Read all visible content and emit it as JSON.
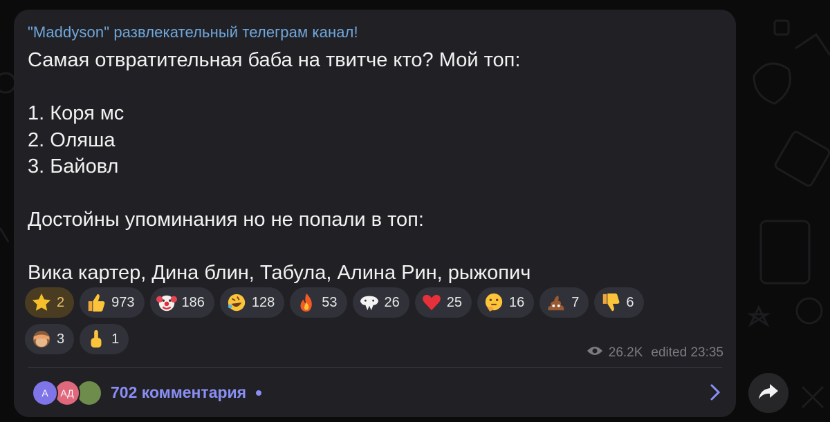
{
  "channel": {
    "name": "\"Maddyson\" развлекательный телеграм канал!"
  },
  "post": {
    "lines": [
      "Самая отвратительная баба на твитче кто? Мой топ:",
      "",
      "1. Коря мс",
      "2. Оляша",
      "3. Байовл",
      "",
      "Достойны упоминания но не попали в топ:",
      "",
      "Вика картер, Дина блин, Табула, Алина Рин, рыжопич"
    ]
  },
  "reactions": [
    {
      "emoji": "star-icon",
      "count": "2",
      "active": true
    },
    {
      "emoji": "thumbs-up-icon",
      "count": "973"
    },
    {
      "emoji": "clown-icon",
      "count": "186"
    },
    {
      "emoji": "rofl-icon",
      "count": "128"
    },
    {
      "emoji": "fire-icon",
      "count": "53"
    },
    {
      "emoji": "whale-icon",
      "count": "26"
    },
    {
      "emoji": "heart-icon",
      "count": "25"
    },
    {
      "emoji": "thinking-icon",
      "count": "16"
    },
    {
      "emoji": "poop-icon",
      "count": "7"
    },
    {
      "emoji": "thumbs-down-icon",
      "count": "6"
    },
    {
      "emoji": "see-no-evil-monkey-icon",
      "count": "3"
    },
    {
      "emoji": "middle-finger-icon",
      "count": "1"
    }
  ],
  "meta": {
    "views": "26.2K",
    "edited": "edited 23:35"
  },
  "comments": {
    "label": "702 комментария",
    "avatars": [
      {
        "initials": "А",
        "color": "#7f75e8"
      },
      {
        "initials": "АД",
        "color": "#e0687c"
      },
      {
        "initials": "",
        "color": "#6e8d4d"
      }
    ]
  },
  "colors": {
    "bubble": "#212125",
    "accent": "#6fa7dd",
    "link": "#8a8ef5"
  }
}
